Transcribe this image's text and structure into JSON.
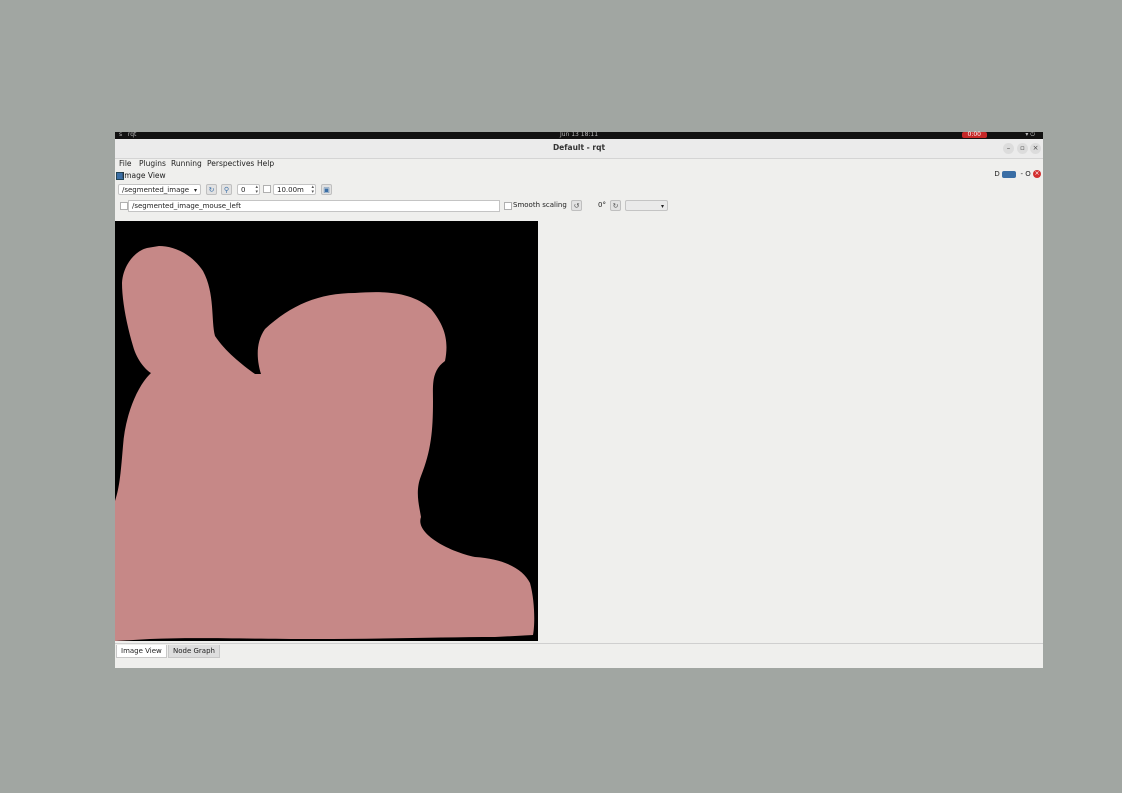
{
  "system_bar": {
    "left": "s",
    "app": "rqt",
    "clock": "Jun 13 18:11",
    "recording": "0:00",
    "tray": "▾ ⏻"
  },
  "window": {
    "title": "Default - rqt",
    "minimize": "–",
    "maximize": "▫",
    "close": "×"
  },
  "menu": [
    "File",
    "Plugins",
    "Running",
    "Perspectives",
    "Help"
  ],
  "plugin": {
    "title": "Image View",
    "title_controls": "D",
    "close_controls": "- O"
  },
  "toolbar": {
    "topic": "/segmented_image",
    "spin_value": "0",
    "rate_value": "10.00m",
    "mouse_topic": "/segmented_image_mouse_left",
    "smooth_scaling_label": "Smooth scaling",
    "rotation": "0°"
  },
  "icons": [
    "refresh-icon",
    "zoom-icon",
    "save-icon",
    "rotate-icon",
    "flip-icon"
  ],
  "colors": {
    "mask": "#c68887",
    "background": "#000000"
  },
  "tabs": [
    "Image View",
    "Node Graph"
  ]
}
